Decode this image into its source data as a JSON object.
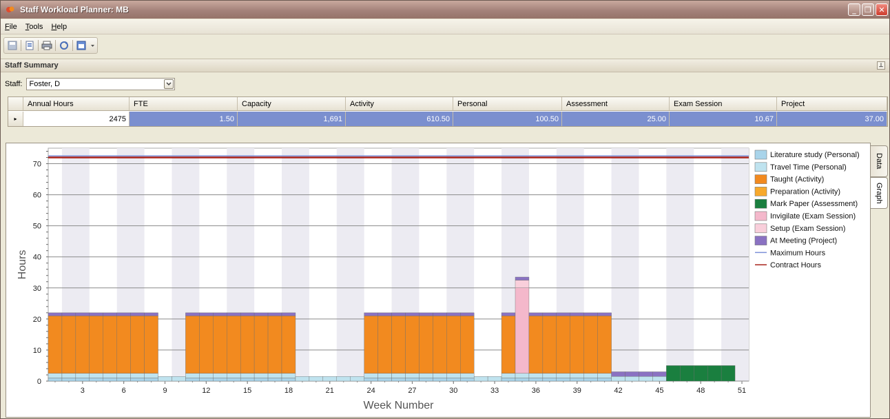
{
  "window": {
    "title": "Staff Workload Planner: MB"
  },
  "menu": {
    "items": [
      "File",
      "Tools",
      "Help"
    ]
  },
  "toolbar": {
    "icons": [
      "save-icon",
      "export-icon",
      "print-icon",
      "refresh-icon",
      "window-icon",
      "dropdown-icon"
    ]
  },
  "panel": {
    "title": "Staff Summary"
  },
  "staff": {
    "label": "Staff:",
    "value": "Foster, D"
  },
  "summary": {
    "columns": [
      "Annual Hours",
      "FTE",
      "Capacity",
      "Activity",
      "Personal",
      "Assessment",
      "Exam Session",
      "Project"
    ],
    "row": [
      "2475",
      "1.50",
      "1,691",
      "610.50",
      "100.50",
      "25.00",
      "10.67",
      "37.00"
    ]
  },
  "tabs": [
    "Data",
    "Graph"
  ],
  "chart_data": {
    "type": "bar",
    "xlabel": "Week Number",
    "ylabel": "Hours",
    "ylim": [
      0,
      75
    ],
    "yticks": [
      0,
      10,
      20,
      30,
      40,
      50,
      60,
      70
    ],
    "xticks": [
      3,
      6,
      9,
      12,
      15,
      18,
      21,
      24,
      27,
      30,
      33,
      36,
      39,
      42,
      45,
      48,
      51
    ],
    "xlim": [
      0.5,
      51.5
    ],
    "weeks": [
      1,
      2,
      3,
      4,
      5,
      6,
      7,
      8,
      9,
      10,
      11,
      12,
      13,
      14,
      15,
      16,
      17,
      18,
      19,
      20,
      21,
      22,
      23,
      24,
      25,
      26,
      27,
      28,
      29,
      30,
      31,
      32,
      33,
      34,
      35,
      36,
      37,
      38,
      39,
      40,
      41,
      42,
      43,
      44,
      45,
      46,
      47,
      48,
      49,
      50,
      51
    ],
    "series": [
      {
        "name": "Literature study (Personal)",
        "color": "#a9d4ea",
        "values": [
          1,
          1,
          1,
          1,
          1,
          1,
          1,
          1,
          0,
          0,
          1,
          1,
          1,
          1,
          1,
          1,
          1,
          1,
          0,
          0,
          0,
          0,
          0,
          1,
          1,
          1,
          1,
          1,
          1,
          1,
          1,
          0,
          0,
          1,
          1,
          1,
          1,
          1,
          1,
          1,
          1,
          0,
          0,
          0,
          0,
          0,
          0,
          0,
          0,
          0,
          0
        ]
      },
      {
        "name": "Travel Time (Personal)",
        "color": "#bfe3ef",
        "values": [
          1.5,
          1.5,
          1.5,
          1.5,
          1.5,
          1.5,
          1.5,
          1.5,
          1.5,
          1.5,
          1.5,
          1.5,
          1.5,
          1.5,
          1.5,
          1.5,
          1.5,
          1.5,
          1.5,
          1.5,
          1.5,
          1.5,
          1.5,
          1.5,
          1.5,
          1.5,
          1.5,
          1.5,
          1.5,
          1.5,
          1.5,
          1.5,
          1.5,
          1.5,
          1.5,
          1.5,
          1.5,
          1.5,
          1.5,
          1.5,
          1.5,
          1.5,
          1.5,
          1.5,
          1.5,
          0,
          0,
          0,
          0,
          0,
          0
        ]
      },
      {
        "name": "Taught (Activity)",
        "color": "#f28a1f",
        "values": [
          18.5,
          18.5,
          18.5,
          18.5,
          18.5,
          18.5,
          18.5,
          18.5,
          0,
          0,
          18.5,
          18.5,
          18.5,
          18.5,
          18.5,
          18.5,
          18.5,
          18.5,
          0,
          0,
          0,
          0,
          0,
          18.5,
          18.5,
          18.5,
          18.5,
          18.5,
          18.5,
          18.5,
          18.5,
          0,
          0,
          18.5,
          0,
          18.5,
          18.5,
          18.5,
          18.5,
          18.5,
          18.5,
          0,
          0,
          0,
          0,
          0,
          0,
          0,
          0,
          0,
          0
        ]
      },
      {
        "name": "Preparation (Activity)",
        "color": "#f7a92c",
        "values": [
          0,
          0,
          0,
          0,
          0,
          0,
          0,
          0,
          0,
          0,
          0,
          0,
          0,
          0,
          0,
          0,
          0,
          0,
          0,
          0,
          0,
          0,
          0,
          0,
          0,
          0,
          0,
          0,
          0,
          0,
          0,
          0,
          0,
          0,
          0,
          0,
          0,
          0,
          0,
          0,
          0,
          0,
          0,
          0,
          0,
          0,
          0,
          0,
          0,
          0,
          0
        ]
      },
      {
        "name": "Mark Paper (Assessment)",
        "color": "#1a7f3f",
        "values": [
          0,
          0,
          0,
          0,
          0,
          0,
          0,
          0,
          0,
          0,
          0,
          0,
          0,
          0,
          0,
          0,
          0,
          0,
          0,
          0,
          0,
          0,
          0,
          0,
          0,
          0,
          0,
          0,
          0,
          0,
          0,
          0,
          0,
          0,
          0,
          0,
          0,
          0,
          0,
          0,
          0,
          0,
          0,
          0,
          0,
          5,
          5,
          5,
          5,
          5,
          0
        ]
      },
      {
        "name": "Invigilate (Exam Session)",
        "color": "#f4b8cb",
        "values": [
          0,
          0,
          0,
          0,
          0,
          0,
          0,
          0,
          0,
          0,
          0,
          0,
          0,
          0,
          0,
          0,
          0,
          0,
          0,
          0,
          0,
          0,
          0,
          0,
          0,
          0,
          0,
          0,
          0,
          0,
          0,
          0,
          0,
          0,
          27.5,
          0,
          0,
          0,
          0,
          0,
          0,
          0,
          0,
          0,
          0,
          0,
          0,
          0,
          0,
          0,
          0
        ]
      },
      {
        "name": "Setup (Exam Session)",
        "color": "#f9cfdb",
        "values": [
          0,
          0,
          0,
          0,
          0,
          0,
          0,
          0,
          0,
          0,
          0,
          0,
          0,
          0,
          0,
          0,
          0,
          0,
          0,
          0,
          0,
          0,
          0,
          0,
          0,
          0,
          0,
          0,
          0,
          0,
          0,
          0,
          0,
          0,
          2.5,
          0,
          0,
          0,
          0,
          0,
          0,
          0,
          0,
          0,
          0,
          0,
          0,
          0,
          0,
          0,
          0
        ]
      },
      {
        "name": "At Meeting (Project)",
        "color": "#8a72c2",
        "values": [
          1,
          1,
          1,
          1,
          1,
          1,
          1,
          1,
          0,
          0,
          1,
          1,
          1,
          1,
          1,
          1,
          1,
          1,
          0,
          0,
          0,
          0,
          0,
          1,
          1,
          1,
          1,
          1,
          1,
          1,
          1,
          0,
          0,
          1,
          1,
          1,
          1,
          1,
          1,
          1,
          1,
          1.5,
          1.5,
          1.5,
          1.5,
          0,
          0,
          0,
          0,
          0,
          0
        ]
      }
    ],
    "lines": [
      {
        "name": "Maximum Hours",
        "color": "#7b8fd8",
        "value": 72.5
      },
      {
        "name": "Contract Hours",
        "color": "#a8231b",
        "value": 72
      }
    ],
    "legend_position": "right",
    "alternating_week_bands": true
  }
}
